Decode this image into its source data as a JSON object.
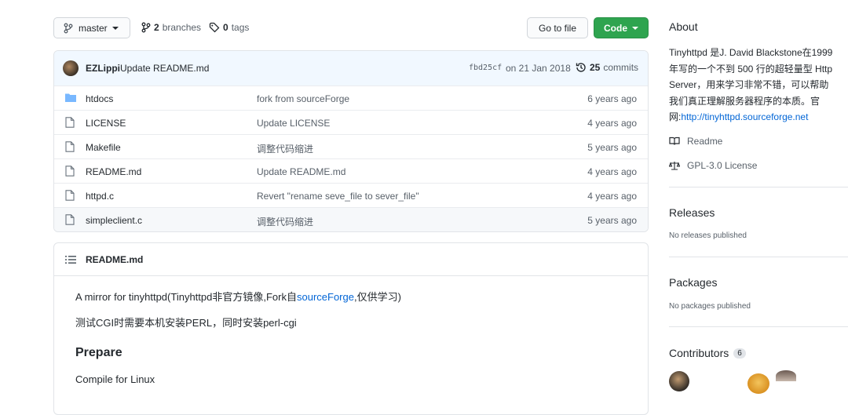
{
  "toolbar": {
    "branch_label": "master",
    "branches_count": "2",
    "branches_label": "branches",
    "tags_count": "0",
    "tags_label": "tags",
    "goto_file": "Go to file",
    "code_button": "Code"
  },
  "commit": {
    "author": "EZLippi",
    "message": "Update README.md",
    "hash": "fbd25cf",
    "date": "on 21 Jan 2018",
    "commits_count": "25",
    "commits_label": "commits"
  },
  "files": [
    {
      "name": "htdocs",
      "type": "folder",
      "message": "fork from sourceForge",
      "age": "6 years ago"
    },
    {
      "name": "LICENSE",
      "type": "file",
      "message": "Update LICENSE",
      "age": "4 years ago"
    },
    {
      "name": "Makefile",
      "type": "file",
      "message": "调整代码缩进",
      "age": "5 years ago"
    },
    {
      "name": "README.md",
      "type": "file",
      "message": "Update README.md",
      "age": "4 years ago"
    },
    {
      "name": "httpd.c",
      "type": "file",
      "message": "Revert \"rename seve_file to sever_file\"",
      "age": "4 years ago"
    },
    {
      "name": "simpleclient.c",
      "type": "file",
      "message": "调整代码缩进",
      "age": "5 years ago"
    }
  ],
  "readme": {
    "header": "README.md",
    "line1_pre": "A mirror for tinyhttpd(Tinyhttpd非官方镜像,Fork自",
    "line1_link": "sourceForge",
    "line1_post": ",仅供学习)",
    "line2": "测试CGI时需要本机安装PERL，同时安装perl-cgi",
    "heading": "Prepare",
    "line3": "Compile for Linux"
  },
  "about": {
    "title": "About",
    "desc_lines": [
      "Tinyhttpd 是J. David Blackstone在1999",
      "年写的一个不到 500 行的超轻量型 Http",
      "Server，用来学习非常不错，可以帮助",
      "我们真正理解服务器程序的本质。官"
    ],
    "desc_last_prefix": "网:",
    "website": "http://tinyhttpd.sourceforge.net",
    "readme_label": "Readme",
    "license_label": "GPL-3.0 License"
  },
  "releases": {
    "title": "Releases",
    "empty": "No releases published"
  },
  "packages": {
    "title": "Packages",
    "empty": "No packages published"
  },
  "contributors": {
    "title": "Contributors",
    "count": "6"
  },
  "colors": {
    "accent": "#0366d6",
    "green": "#2ea44f",
    "folder": "#79b8ff"
  }
}
